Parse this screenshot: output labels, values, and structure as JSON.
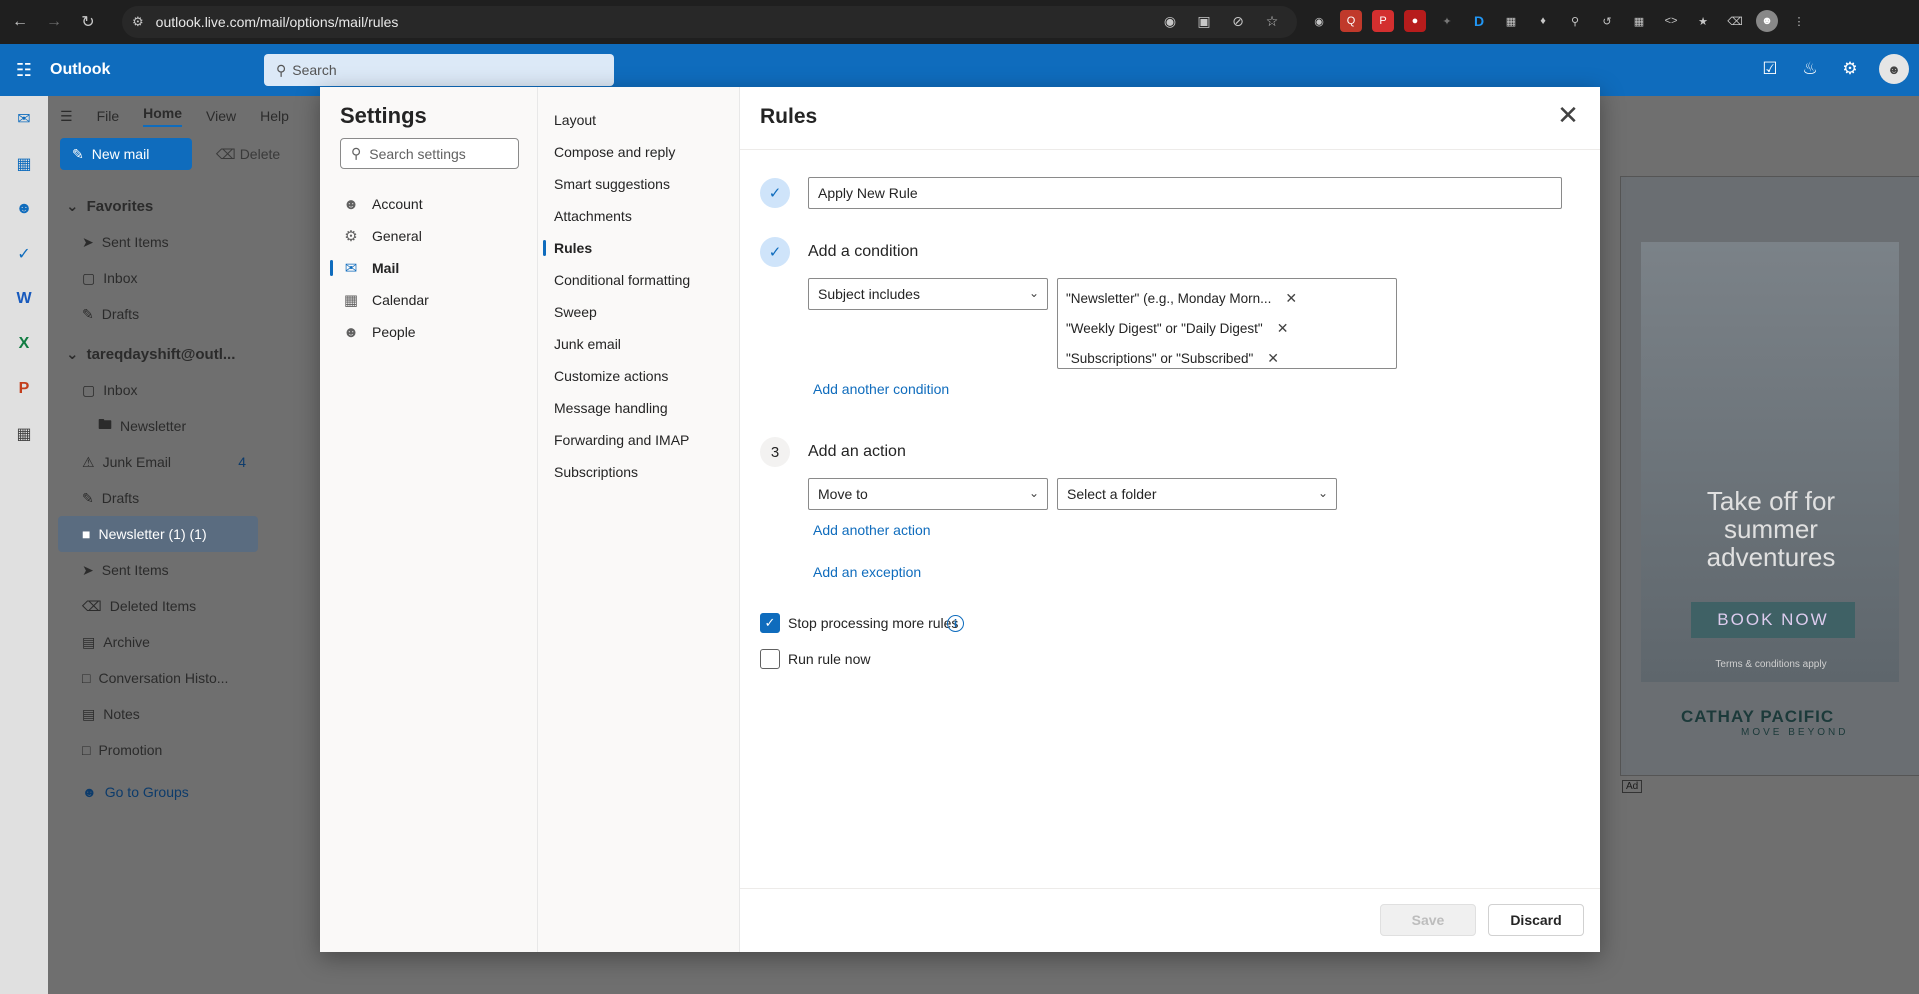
{
  "browser": {
    "url": "outlook.live.com/mail/options/mail/rules"
  },
  "outlook": {
    "brand": "Outlook",
    "search_placeholder": "Search",
    "ribbon_tabs": [
      "File",
      "Home",
      "View",
      "Help"
    ],
    "new_mail": "New mail",
    "delete": "Delete"
  },
  "folders": {
    "favorites": "Favorites",
    "fav_items": [
      "Sent Items",
      "Inbox",
      "Drafts"
    ],
    "account": "tareqdayshift@outl...",
    "inbox": "Inbox",
    "newsletter": "Newsletter",
    "junk": "Junk Email",
    "junk_count": "4",
    "drafts": "Drafts",
    "newsletter_sel": "Newsletter (1) (1)",
    "sent": "Sent Items",
    "deleted": "Deleted Items",
    "archive": "Archive",
    "conversation": "Conversation Histo...",
    "notes": "Notes",
    "promotion": "Promotion",
    "groups": "Go to Groups"
  },
  "ad": {
    "headline": "Take off for summer adventures",
    "cta": "BOOK NOW",
    "terms": "Terms & conditions apply",
    "logo": "CATHAY PACIFIC",
    "tagline": "MOVE BEYOND",
    "badge": "Ad"
  },
  "settings": {
    "title": "Settings",
    "search_placeholder": "Search settings",
    "categories": [
      "Account",
      "General",
      "Mail",
      "Calendar",
      "People"
    ],
    "mail_sections": [
      "Layout",
      "Compose and reply",
      "Smart suggestions",
      "Attachments",
      "Rules",
      "Conditional formatting",
      "Sweep",
      "Junk email",
      "Customize actions",
      "Message handling",
      "Forwarding and IMAP",
      "Subscriptions"
    ]
  },
  "rules": {
    "title": "Rules",
    "rule_name": "Apply New Rule",
    "add_condition": "Add a condition",
    "condition_type": "Subject includes",
    "condition_values": [
      "\"Newsletter\" (e.g., Monday Morn...",
      "\"Weekly Digest\" or \"Daily Digest\"",
      "\"Subscriptions\" or \"Subscribed\""
    ],
    "add_another_condition": "Add another condition",
    "step3": "3",
    "add_action": "Add an action",
    "action_type": "Move to",
    "folder_placeholder": "Select a folder",
    "add_another_action": "Add another action",
    "add_exception": "Add an exception",
    "stop_processing": "Stop processing more rules",
    "run_rule_now": "Run rule now",
    "save": "Save",
    "discard": "Discard"
  }
}
